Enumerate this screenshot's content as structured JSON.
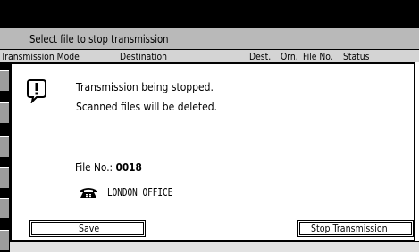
{
  "header": {
    "title": "Select file to stop transmission"
  },
  "columns": {
    "transmission_mode": "Transmission Mode",
    "destination": "Destination",
    "dest": "Dest.",
    "orn": "Orn.",
    "file_no": "File No.",
    "status": "Status"
  },
  "dialog": {
    "icon": "warning-icon",
    "message_line1": "Transmission being stopped.",
    "message_line2": "Scanned files will be deleted.",
    "file_label": "File No.:",
    "file_number": "0018",
    "destination_icon": "telephone-icon",
    "destination": "LONDON OFFICE",
    "save_label": "Save",
    "stop_label": "Stop Transmission"
  }
}
